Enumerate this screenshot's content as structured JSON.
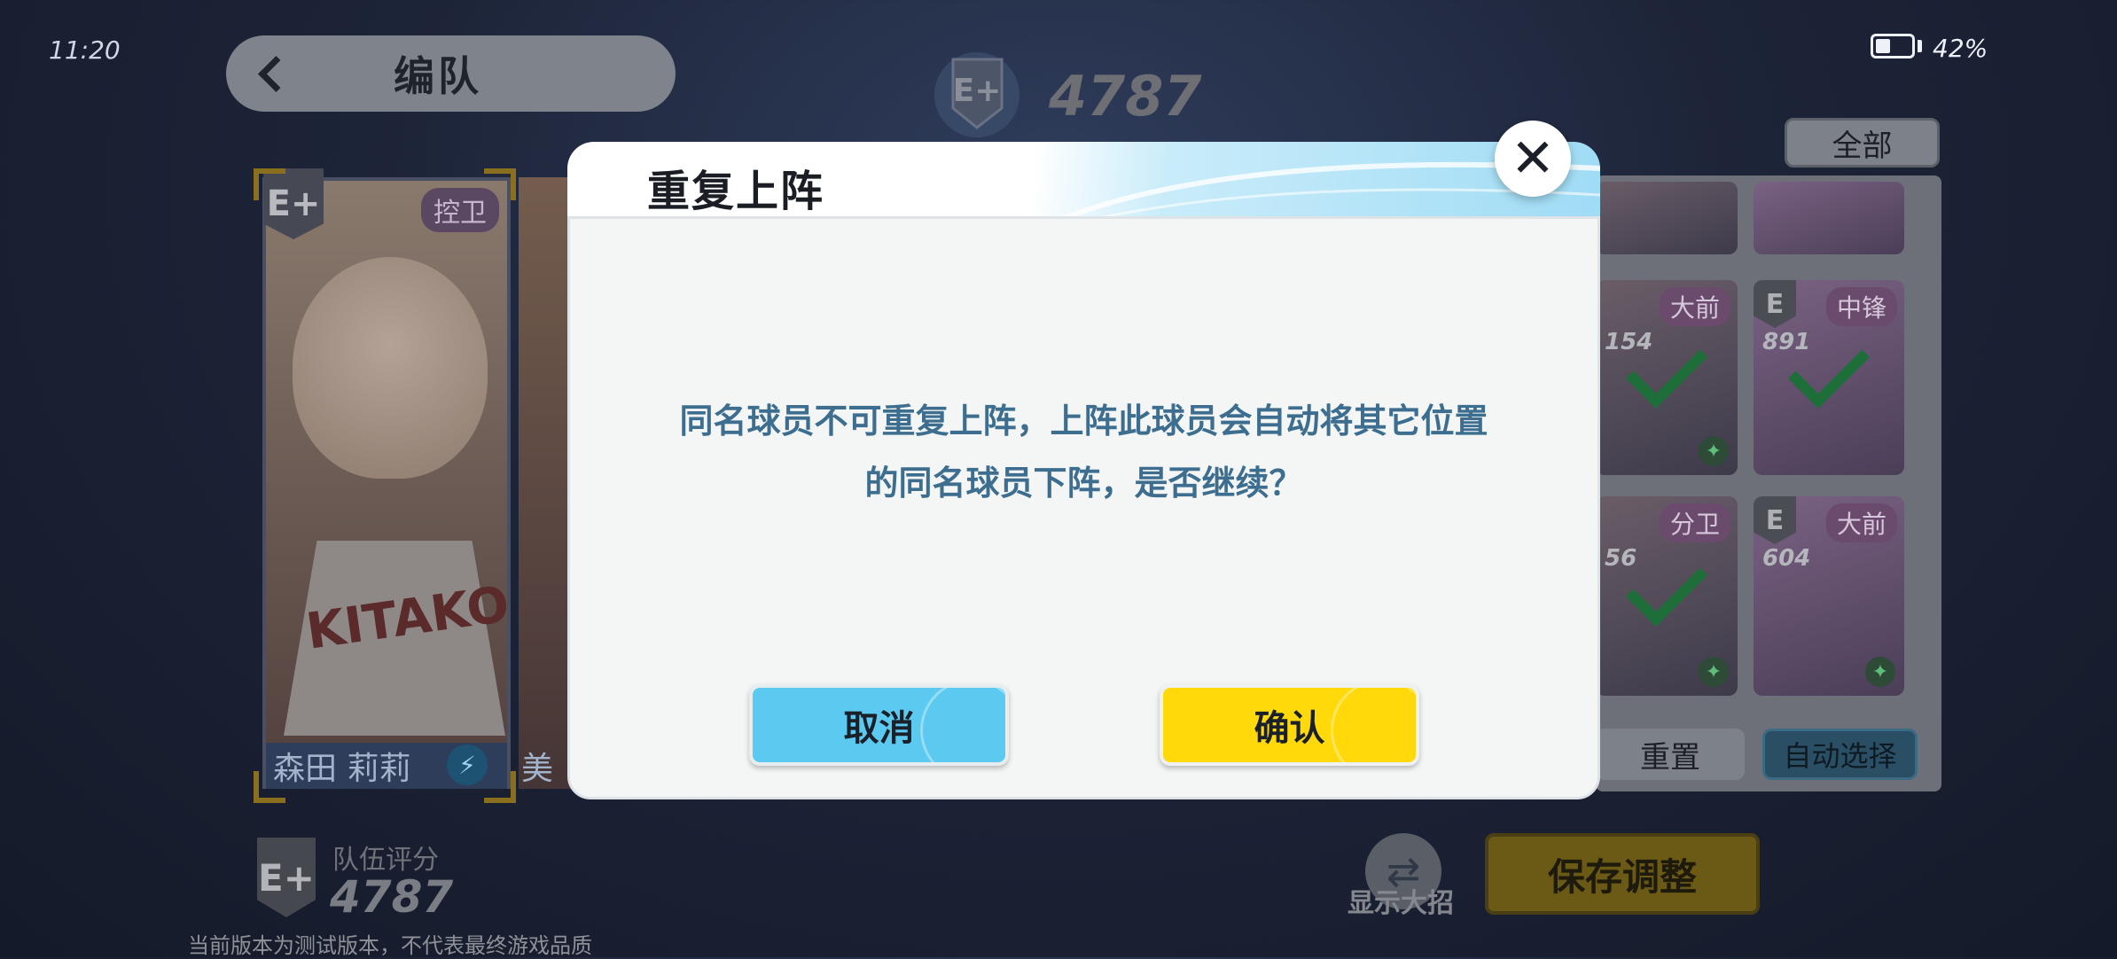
{
  "status_bar": {
    "time": "11:20",
    "battery_percent": "42%",
    "battery_level": 0.42
  },
  "header": {
    "title": "编队",
    "team_score": "4787",
    "rank": "E+"
  },
  "filter": {
    "label": "全部"
  },
  "main_card": {
    "rank": "E+",
    "position": "控卫",
    "name": "森田 莉莉",
    "jersey": "KITAKO",
    "skill_icon": "lightning-icon",
    "second_name": "美"
  },
  "roster_cards": [
    {
      "position": "大前",
      "number": "154",
      "checked": true
    },
    {
      "position": "中锋",
      "number": "891",
      "rank": "E",
      "checked": true
    },
    {
      "position": "分卫",
      "number": "56",
      "checked": true
    },
    {
      "position": "大前",
      "number": "604",
      "rank": "E",
      "checked": false
    }
  ],
  "roster_buttons": {
    "reset": "重置",
    "auto_select": "自动选择"
  },
  "footer": {
    "rank": "E+",
    "team_label": "队伍评分",
    "team_score": "4787",
    "disclaimer": "当前版本为测试版本，不代表最终游戏品质",
    "show_ultimate": "显示大招",
    "save": "保存调整"
  },
  "dialog": {
    "title": "重复上阵",
    "message_line1": "同名球员不可重复上阵，上阵此球员会自动将其它位置",
    "message_line2": "的同名球员下阵，是否继续？",
    "cancel": "取消",
    "confirm": "确认"
  },
  "colors": {
    "accent_blue": "#5ccaf0",
    "accent_yellow": "#ffd90a",
    "message_text": "#3d6e8f"
  }
}
